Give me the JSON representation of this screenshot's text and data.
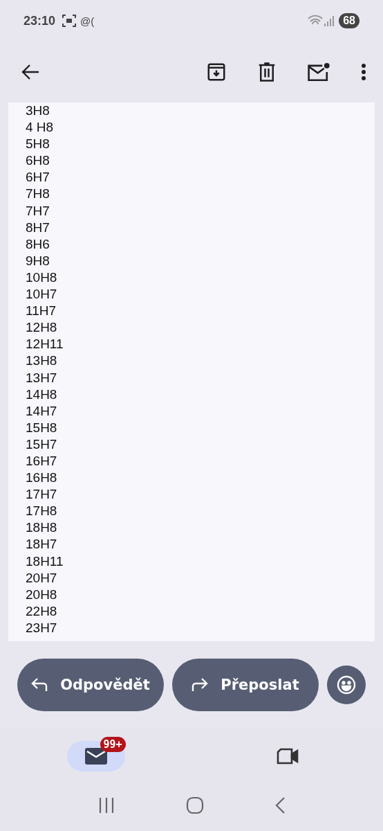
{
  "status_bar": {
    "time": "23:10",
    "notification_text": "@(",
    "battery": "68"
  },
  "toolbar": {
    "actions": [
      {
        "kind": "archive"
      },
      {
        "kind": "delete"
      },
      {
        "kind": "unread"
      },
      {
        "kind": "more"
      }
    ]
  },
  "message": {
    "lines": [
      "3H8",
      "4 H8",
      "5H8",
      "6H8",
      "6H7",
      "7H8",
      "7H7",
      "8H7",
      "8H6",
      "9H8",
      "10H8",
      "10H7",
      "11H7",
      "12H8",
      "12H11",
      "13H8",
      "13H7",
      "14H8",
      "14H7",
      "15H8",
      "15H7",
      "16H7",
      "16H8",
      "17H7",
      "17H8",
      "18H8",
      "18H7",
      "18H11",
      "20H7",
      "20H8",
      "22H8",
      "23H7"
    ]
  },
  "actions": [
    {
      "kind": "reply",
      "label": "Odpovědět"
    },
    {
      "kind": "forward",
      "label": "Přeposlat"
    },
    {
      "kind": "emoji"
    }
  ],
  "bottom_nav": [
    {
      "kind": "mail",
      "selected": true,
      "badge": "99+"
    },
    {
      "kind": "meet",
      "selected": false
    }
  ]
}
